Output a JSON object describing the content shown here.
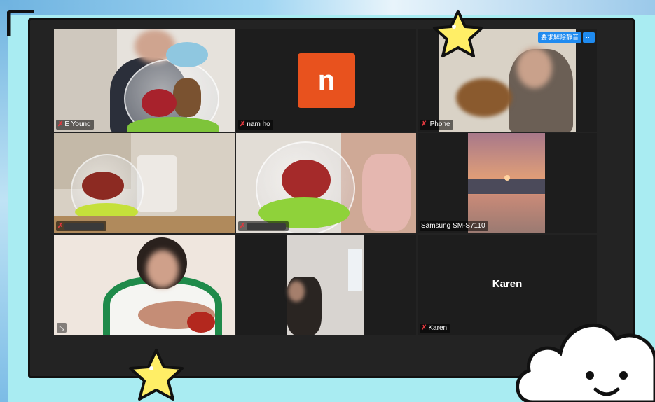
{
  "participants": [
    {
      "name": "E Young",
      "muted": true
    },
    {
      "name": "nam ho",
      "muted": true,
      "avatar_letter": "n",
      "avatar_color": "#e8521e"
    },
    {
      "name": "iPhone",
      "muted": true
    },
    {
      "name": "",
      "muted": true
    },
    {
      "name": "",
      "muted": true
    },
    {
      "name": "Samsung SM-S7110",
      "muted": false
    },
    {
      "name": "",
      "muted": false
    },
    {
      "name": "",
      "muted": false
    },
    {
      "name": "Karen",
      "muted": true,
      "display_name": "Karen"
    }
  ],
  "controls": {
    "translate_label": "要求解除靜音",
    "more_label": "···"
  },
  "colors": {
    "accent": "#1f8bf0",
    "muted_icon": "#e0383e",
    "background": "#a9ecf2"
  },
  "decor": {
    "stars": [
      "star-icon",
      "star-icon"
    ],
    "cloud": "cloud-face-icon"
  }
}
